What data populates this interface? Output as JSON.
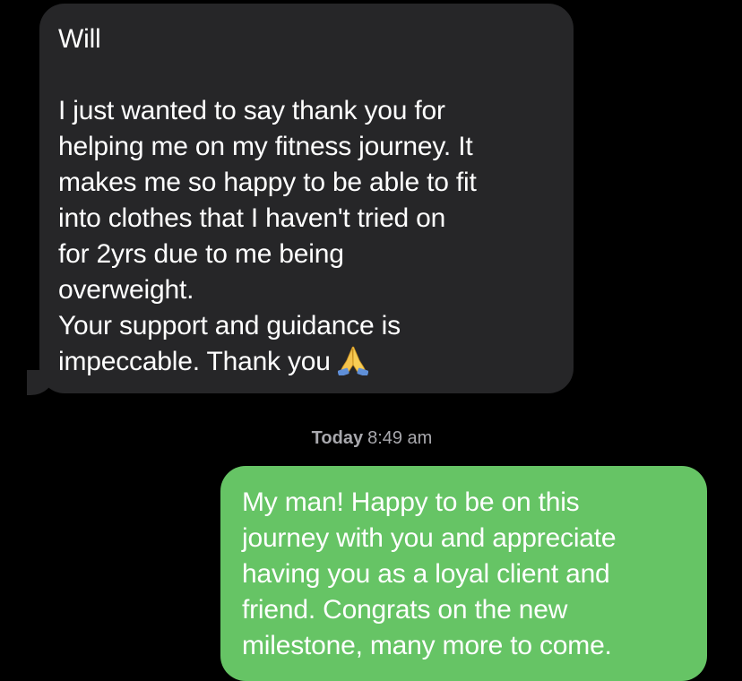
{
  "conversation": {
    "received_message": {
      "sender_line": "Will",
      "body_lines": [
        "I just wanted to say thank you for",
        "helping me on my fitness journey. It",
        "makes me so happy to be able to fit",
        "into clothes that I haven't tried on",
        "for 2yrs due to me being",
        "overweight.",
        "Your support and guidance is",
        "impeccable. Thank you"
      ],
      "trailing_emoji": "folded-hands-icon",
      "bubble_color": "#262628"
    },
    "timestamp": {
      "day": "Today",
      "time": "8:49 am"
    },
    "sent_message": {
      "lines": [
        "My man! Happy to be on this",
        "journey with you and appreciate",
        "having you as a loyal client and",
        "friend. Congrats on the new",
        "milestone, many more to come."
      ],
      "bubble_color": "#66c465"
    }
  }
}
